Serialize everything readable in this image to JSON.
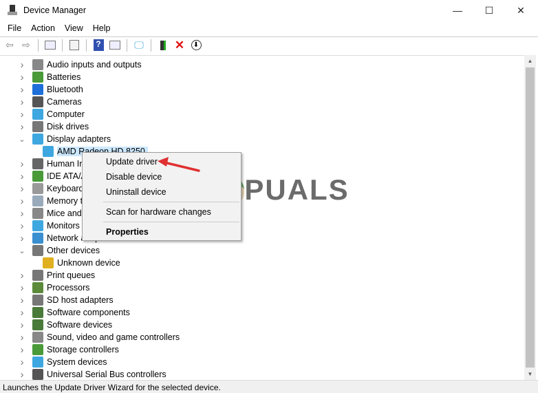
{
  "window": {
    "title": "Device Manager",
    "minimize": "—",
    "maximize": "☐",
    "close": "✕"
  },
  "menu": [
    "File",
    "Action",
    "View",
    "Help"
  ],
  "toolbar": {
    "icons": [
      "back-icon",
      "forward-icon",
      "show-hide-tree-icon",
      "properties-icon",
      "help-icon",
      "run-icon",
      "scan-hardware-icon",
      "update-driver-icon",
      "uninstall-icon",
      "download-icon"
    ]
  },
  "tree": [
    {
      "label": "Audio inputs and outputs",
      "state": "collapsed",
      "level": 0,
      "color": "#888"
    },
    {
      "label": "Batteries",
      "state": "collapsed",
      "level": 0,
      "color": "#4a9a3a"
    },
    {
      "label": "Bluetooth",
      "state": "collapsed",
      "level": 0,
      "color": "#1e6fd9"
    },
    {
      "label": "Cameras",
      "state": "collapsed",
      "level": 0,
      "color": "#555"
    },
    {
      "label": "Computer",
      "state": "collapsed",
      "level": 0,
      "color": "#3fa7e0"
    },
    {
      "label": "Disk drives",
      "state": "collapsed",
      "level": 0,
      "color": "#777"
    },
    {
      "label": "Display adapters",
      "state": "expanded",
      "level": 0,
      "color": "#3fa7e0"
    },
    {
      "label": "AMD Radeon HD 8250",
      "state": "leaf",
      "level": 1,
      "color": "#3fa7e0",
      "selected": true
    },
    {
      "label": "Human Interface Devices",
      "state": "collapsed",
      "level": 0,
      "color": "#666"
    },
    {
      "label": "IDE ATA/ATAPI controllers",
      "state": "collapsed",
      "level": 0,
      "color": "#4a9a3a"
    },
    {
      "label": "Keyboards",
      "state": "collapsed",
      "level": 0,
      "color": "#999"
    },
    {
      "label": "Memory technology devices",
      "state": "collapsed",
      "level": 0,
      "color": "#9ab"
    },
    {
      "label": "Mice and other pointing devices",
      "state": "collapsed",
      "level": 0,
      "color": "#888"
    },
    {
      "label": "Monitors",
      "state": "collapsed",
      "level": 0,
      "color": "#3fa7e0"
    },
    {
      "label": "Network adapters",
      "state": "collapsed",
      "level": 0,
      "color": "#3a8fd0"
    },
    {
      "label": "Other devices",
      "state": "expanded",
      "level": 0,
      "color": "#777"
    },
    {
      "label": "Unknown device",
      "state": "leaf",
      "level": 1,
      "color": "#e0b020"
    },
    {
      "label": "Print queues",
      "state": "collapsed",
      "level": 0,
      "color": "#777"
    },
    {
      "label": "Processors",
      "state": "collapsed",
      "level": 0,
      "color": "#5a8a3a"
    },
    {
      "label": "SD host adapters",
      "state": "collapsed",
      "level": 0,
      "color": "#777"
    },
    {
      "label": "Software components",
      "state": "collapsed",
      "level": 0,
      "color": "#4a7a3a"
    },
    {
      "label": "Software devices",
      "state": "collapsed",
      "level": 0,
      "color": "#4a7a3a"
    },
    {
      "label": "Sound, video and game controllers",
      "state": "collapsed",
      "level": 0,
      "color": "#888"
    },
    {
      "label": "Storage controllers",
      "state": "collapsed",
      "level": 0,
      "color": "#4a9a3a"
    },
    {
      "label": "System devices",
      "state": "collapsed",
      "level": 0,
      "color": "#3fa7e0"
    },
    {
      "label": "Universal Serial Bus controllers",
      "state": "collapsed",
      "level": 0,
      "color": "#555"
    }
  ],
  "context_menu": {
    "items": [
      "Update driver",
      "Disable device",
      "Uninstall device",
      "Scan for hardware changes",
      "Properties"
    ]
  },
  "watermark": "APPUALS",
  "status": "Launches the Update Driver Wizard for the selected device."
}
